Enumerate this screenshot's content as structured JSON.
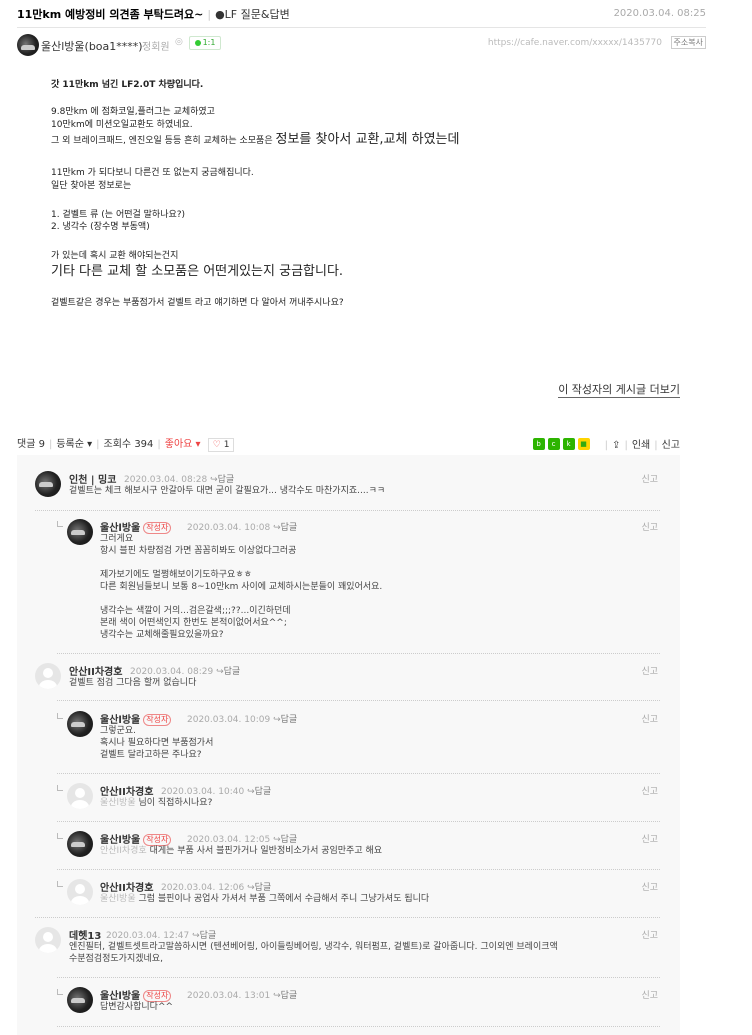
{
  "header": {
    "title": "11만km 예방정비 의견좀 부탁드려요~",
    "board": "●LF 질문&답변",
    "date": "2020.03.04. 08:25"
  },
  "author": {
    "name": "울산l방울(boa1****)",
    "grade": "정회원",
    "chat": "1:1",
    "url": "https://cafe.naver.com/xxxxx/1435770",
    "copy_label": "주소복사"
  },
  "body": {
    "line1": "갓 11만km 넘긴 LF2.0T 차량입니다.",
    "line2": "9.8만km 에  점화코일,플러그는 교체하였고",
    "line3": "10만km에 미션오일교환도 하였네요.",
    "line4a": "그 외 브레이크패드, 엔진오일  등등 흔히 교체하는 소모품은  ",
    "line4b": "정보를 찾아서 교환,교체 하였는데",
    "line5": "11만km 가 되다보니 다른건 또 없는지 궁금해집니다.",
    "line6": "일단 찾아본 정보로는",
    "line7": "1. 겉벨트 류  (는 어떤걸 말하나요?)",
    "line8": "2. 냉각수 (장수명 부동액)",
    "line9": "가 있는데 혹시 교환 해야되는건지",
    "line10": "기타 다른 교체 할 소모품은 어떤게있는지 궁금합니다.",
    "line11": "겉벨트같은 경우는 부품점가서 겉벨트 라고 얘기하면 다 알아서 꺼내주시나요?"
  },
  "more_posts": "이 작성자의 게시글 더보기",
  "comment_bar": {
    "comments_label": "댓글 9",
    "sort_label": "등록순 ▾",
    "views_label": "조회수",
    "views": "394",
    "like_label": "좋아요 ▾",
    "like_count": "1",
    "print": "인쇄",
    "report": "신고"
  },
  "reply_label": "답글",
  "report_label": "신고",
  "writer_label": "작성자",
  "comments": [
    {
      "nick": "인천 | 밍코",
      "date": "2020.03.04. 08:28",
      "text": "겉벨트는 체크 해보시구 안갈아두 대면 굳이 갈필요가... 냉각수도 마찬가지죠....ㅋㅋ"
    },
    {
      "nick": "울산l방울",
      "date": "2020.03.04. 10:08",
      "text": "그러게요\n항시 블핀 차량점검 가면 꼼꼼히봐도 이상없다그러공\n\n제가보기에도 멀쩡해보이기도하구요ㅎㅎ\n다른 회원님들보니 보통 8~10만km 사이에 교체하시는분들이 꽤있어서요.\n\n냉각수는 색깔이 거의...검은갈색;;;??...이긴하던데\n본래 색이 어떤색인지 한번도 본적이없어서요^^;\n냉각수는 교체해줄필요있을까요?"
    },
    {
      "nick": "안산II차경호",
      "date": "2020.03.04. 08:29",
      "text": "겉벨트 점검 그다음 할꺼 없습니다"
    },
    {
      "nick": "울산l방울",
      "date": "2020.03.04. 10:09",
      "text": "그렇군요.\n혹시나 필요하다면 부품점가서\n겉벨트 달라고하믄 주나요?"
    },
    {
      "nick": "안산II차경호",
      "date": "2020.03.04. 10:40",
      "mention": "울산l방울",
      "text": " 님이 직접하시나요?"
    },
    {
      "nick": "울산l방울",
      "date": "2020.03.04. 12:05",
      "mention": "안산II차경호",
      "text": " 대게는 부품 사서 블핀가거나 일반정비소가서 공임만주고 해요"
    },
    {
      "nick": "안산II차경호",
      "date": "2020.03.04. 12:06",
      "mention": "울산l방울",
      "text": " 그럼 블핀이나 공업사 가셔서 부품 그쪽에서 수급해서 주니 그냥가셔도 됩니다"
    },
    {
      "nick": "데헷13",
      "date": "2020.03.04. 12:47",
      "text": "엔진필터, 겉벨트셋트라고말씀하시면 (텐션베어링, 아이들링베어링, 냉각수, 워터펌프, 겉벨트)로 갈아줍니다. 그이외엔 브레이크액\n수분점검정도가지겠네요,"
    },
    {
      "nick": "울산l방울",
      "date": "2020.03.04. 13:01",
      "text": "답변감사합니다^^"
    }
  ]
}
